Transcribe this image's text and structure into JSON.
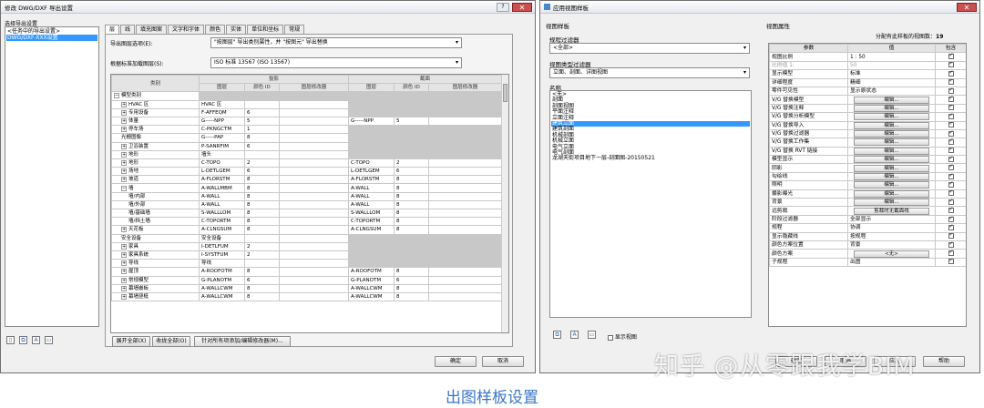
{
  "left_window": {
    "title": "修改 DWG/DXF 导出设置",
    "settings_label": "选择导出设置",
    "settings_items": [
      "<任务中的导出设置>",
      "DWG/DXF-XXX设置"
    ],
    "tabs": [
      "层",
      "线",
      "填充图案",
      "文字和字体",
      "颜色",
      "实体",
      "单位和坐标",
      "常规"
    ],
    "layer_options_label": "导出图层选项(E):",
    "layer_options_value": "\"按图层\" 导出类别属性，并 \"按图元\" 导出替换",
    "standard_label": "根据标准加载图层(S):",
    "standard_value": "ISO 标准 13567 (ISO 13567)",
    "col_category": "类别",
    "col_projection": "投影",
    "col_cut": "截面",
    "sub_headers": [
      "图层",
      "颜色 ID",
      "图层修改器",
      "图层",
      "颜色 ID",
      "图层修改器"
    ],
    "rows": [
      {
        "exp": "−",
        "name": "模型类别",
        "pl": "",
        "pc": "",
        "cl": "",
        "cc": "",
        "lvl": 0,
        "cut": "none"
      },
      {
        "exp": "+",
        "name": "HVAC 区",
        "pl": "HVAC 区",
        "pc": "",
        "cl": "",
        "cc": "",
        "lvl": 1,
        "cut": "gray"
      },
      {
        "exp": "+",
        "name": "专用设备",
        "pl": "F-AFFEQM",
        "pc": "6",
        "cl": "",
        "cc": "",
        "lvl": 1,
        "cut": "gray"
      },
      {
        "exp": "+",
        "name": "体量",
        "pl": "G-----NPP",
        "pc": "5",
        "cl": "G-----NPP",
        "cc": "5",
        "lvl": 1,
        "cut": "white"
      },
      {
        "exp": "+",
        "name": "停车场",
        "pl": "C-PKNGCTM",
        "pc": "1",
        "cl": "",
        "cc": "",
        "lvl": 1,
        "cut": "gray"
      },
      {
        "exp": "",
        "name": "光栅图像",
        "pl": "G-----PAP",
        "pc": "8",
        "cl": "",
        "cc": "",
        "lvl": 1,
        "cut": "gray"
      },
      {
        "exp": "+",
        "name": "卫浴装置",
        "pl": "P-SANRFIM",
        "pc": "6",
        "cl": "",
        "cc": "",
        "lvl": 1,
        "cut": "gray"
      },
      {
        "exp": "+",
        "name": "地形",
        "pl": "墙头",
        "pc": "",
        "cl": "",
        "cc": "",
        "lvl": 1,
        "cut": "gray"
      },
      {
        "exp": "+",
        "name": "地形",
        "pl": "C-TOPO",
        "pc": "2",
        "cl": "C-TOPO",
        "cc": "2",
        "lvl": 1,
        "cut": "white"
      },
      {
        "exp": "+",
        "name": "场地",
        "pl": "L-DETLGEM",
        "pc": "6",
        "cl": "L-DETLGEM",
        "cc": "6",
        "lvl": 1,
        "cut": "white"
      },
      {
        "exp": "+",
        "name": "坡道",
        "pl": "A-FLORSTM",
        "pc": "8",
        "cl": "A-FLORSTM",
        "cc": "8",
        "lvl": 1,
        "cut": "white"
      },
      {
        "exp": "−",
        "name": "墙",
        "pl": "A-WALLMBM",
        "pc": "8",
        "cl": "A-WALL",
        "cc": "8",
        "lvl": 1,
        "cut": "white"
      },
      {
        "exp": "",
        "name": "墙/内部",
        "pl": "A-WALL",
        "pc": "8",
        "cl": "A-WALL",
        "cc": "8",
        "lvl": 2,
        "cut": "white"
      },
      {
        "exp": "",
        "name": "墙/外部",
        "pl": "A-WALL",
        "pc": "8",
        "cl": "A-WALL",
        "cc": "8",
        "lvl": 2,
        "cut": "white"
      },
      {
        "exp": "",
        "name": "墙/基础墙",
        "pl": "S-WALLLOM",
        "pc": "8",
        "cl": "S-WALLLOM",
        "cc": "8",
        "lvl": 2,
        "cut": "white"
      },
      {
        "exp": "",
        "name": "墙/挡土墙",
        "pl": "C-TOPORTM",
        "pc": "8",
        "cl": "C-TOPORTM",
        "cc": "8",
        "lvl": 2,
        "cut": "white"
      },
      {
        "exp": "+",
        "name": "天花板",
        "pl": "A-CLNGSUM",
        "pc": "8",
        "cl": "A-CLNGSUM",
        "cc": "8",
        "lvl": 1,
        "cut": "white"
      },
      {
        "exp": "",
        "name": "安全设备",
        "pl": "安全设备",
        "pc": "",
        "cl": "",
        "cc": "",
        "lvl": 1,
        "cut": "gray"
      },
      {
        "exp": "+",
        "name": "家具",
        "pl": "I-DETLFUM",
        "pc": "2",
        "cl": "",
        "cc": "",
        "lvl": 1,
        "cut": "gray"
      },
      {
        "exp": "+",
        "name": "家具系统",
        "pl": "I-SYSTFUM",
        "pc": "2",
        "cl": "",
        "cc": "",
        "lvl": 1,
        "cut": "gray"
      },
      {
        "exp": "+",
        "name": "导线",
        "pl": "导线",
        "pc": "",
        "cl": "",
        "cc": "",
        "lvl": 1,
        "cut": "gray"
      },
      {
        "exp": "+",
        "name": "屋顶",
        "pl": "A-ROOFOTM",
        "pc": "8",
        "cl": "A-ROOFOTM",
        "cc": "8",
        "lvl": 1,
        "cut": "white"
      },
      {
        "exp": "+",
        "name": "常规模型",
        "pl": "G-PLANOTM",
        "pc": "6",
        "cl": "G-PLANOTM",
        "cc": "6",
        "lvl": 1,
        "cut": "white"
      },
      {
        "exp": "+",
        "name": "幕墙嵌板",
        "pl": "A-WALLCWM",
        "pc": "8",
        "cl": "A-WALLCWM",
        "cc": "8",
        "lvl": 1,
        "cut": "white"
      },
      {
        "exp": "+",
        "name": "幕墙竖梃",
        "pl": "A-WALLCWM",
        "pc": "8",
        "cl": "A-WALLCWM",
        "cc": "8",
        "lvl": 1,
        "cut": "white"
      }
    ],
    "expand_all": "展开全部(X)",
    "collapse_all": "收拢全部(O)",
    "add_modifiers": "针对所有项添加/编辑修改器(M)...",
    "ok": "确定",
    "cancel": "取消"
  },
  "right_window": {
    "title": "应用视图样板",
    "templates_section": "视图样板",
    "discipline_label": "规程过滤器",
    "discipline_value": "<全部>",
    "view_type_label": "视图类型过滤器",
    "view_type_value": "立面、剖面、详图视图",
    "names_label": "名称",
    "names": [
      "<无>",
      "剖面",
      "剖面视图",
      "平面注释",
      "立面注释",
      "建筑立面",
      "建筑剖面",
      "机械剖面",
      "机械立面",
      "电气立面",
      "电气剖面",
      "龙湖天街项目地下一层-剖面图-20150521"
    ],
    "selected_index": 5,
    "show_views_label": "显示视图",
    "props_section": "视图属性",
    "assigned_label": "分配有此样板的视图数：",
    "assigned_count": "19",
    "col_param": "参数",
    "col_value": "值",
    "col_include": "包含",
    "props": [
      {
        "p": "视图比例",
        "v": "1 : 50",
        "btn": false,
        "dim": false
      },
      {
        "p": "比例值 1:",
        "v": "50",
        "btn": false,
        "dim": true
      },
      {
        "p": "显示模型",
        "v": "标准",
        "btn": false,
        "dim": false
      },
      {
        "p": "详细程度",
        "v": "精细",
        "btn": false,
        "dim": false
      },
      {
        "p": "零件可见性",
        "v": "显示原状态",
        "btn": false,
        "dim": false
      },
      {
        "p": "V/G 替换模型",
        "v": "编辑...",
        "btn": true,
        "dim": false
      },
      {
        "p": "V/G 替换注释",
        "v": "编辑...",
        "btn": true,
        "dim": false
      },
      {
        "p": "V/G 替换分析模型",
        "v": "编辑...",
        "btn": true,
        "dim": false
      },
      {
        "p": "V/G 替换导入",
        "v": "编辑...",
        "btn": true,
        "dim": false
      },
      {
        "p": "V/G 替换过滤器",
        "v": "编辑...",
        "btn": true,
        "dim": false
      },
      {
        "p": "V/G 替换工作集",
        "v": "编辑...",
        "btn": true,
        "dim": false
      },
      {
        "p": "V/G 替换 RVT 链接",
        "v": "编辑...",
        "btn": true,
        "dim": false
      },
      {
        "p": "模型显示",
        "v": "编辑...",
        "btn": true,
        "dim": false
      },
      {
        "p": "阴影",
        "v": "编辑...",
        "btn": true,
        "dim": false
      },
      {
        "p": "勾绘线",
        "v": "编辑...",
        "btn": true,
        "dim": false
      },
      {
        "p": "照明",
        "v": "编辑...",
        "btn": true,
        "dim": false
      },
      {
        "p": "摄影曝光",
        "v": "编辑...",
        "btn": true,
        "dim": false
      },
      {
        "p": "背景",
        "v": "编辑...",
        "btn": true,
        "dim": false
      },
      {
        "p": "远剪裁",
        "v": "剪裁时无截面线",
        "btn": true,
        "dim": false
      },
      {
        "p": "阶段过滤器",
        "v": "全部显示",
        "btn": false,
        "dim": false
      },
      {
        "p": "规程",
        "v": "协调",
        "btn": false,
        "dim": false
      },
      {
        "p": "显示隐藏线",
        "v": "按规程",
        "btn": false,
        "dim": false
      },
      {
        "p": "颜色方案位置",
        "v": "背景",
        "btn": false,
        "dim": false
      },
      {
        "p": "颜色方案",
        "v": "<无>",
        "btn": true,
        "dim": false
      },
      {
        "p": "子规程",
        "v": "出图",
        "btn": false,
        "dim": false
      }
    ]
  },
  "caption": "出图样板设置",
  "watermark": "知乎 @从零跟我学BIM"
}
